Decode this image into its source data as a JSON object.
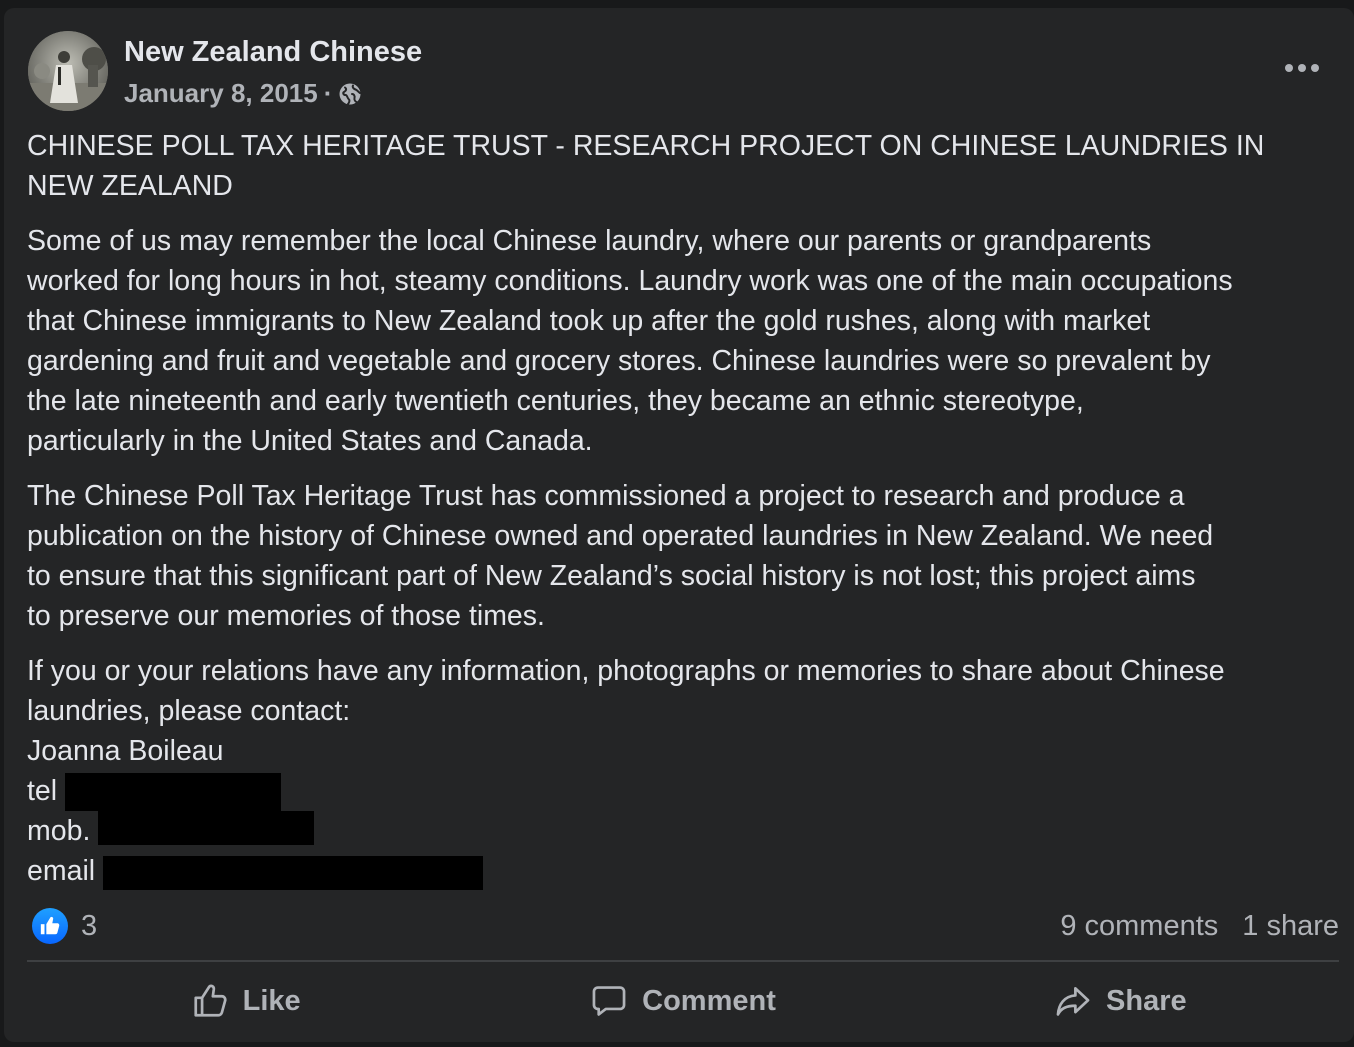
{
  "post": {
    "page_name": "New Zealand Chinese",
    "date": "January 8, 2015",
    "separator": "·",
    "privacy_icon": "globe-icon",
    "more_icon": "more-horizontal-icon",
    "heading_lines": [
      "CHINESE POLL TAX HERITAGE TRUST - RESEARCH PROJECT ON CHINESE LAUNDRIES IN",
      "NEW ZEALAND"
    ],
    "paragraph1_lines": [
      "Some of us may remember the local Chinese laundry, where our parents or grandparents",
      "worked for long hours in hot, steamy conditions. Laundry work was one of the main occupations",
      "that Chinese immigrants to New Zealand took up after the gold rushes, along with market",
      "gardening and fruit and vegetable and grocery stores. Chinese laundries were so prevalent by",
      "the late nineteenth and early twentieth centuries, they became an ethnic stereotype,",
      "particularly in the United States and Canada."
    ],
    "paragraph2_lines": [
      "The Chinese Poll Tax Heritage Trust has commissioned a project to research and produce a",
      "publication on the history of Chinese owned and operated laundries in New Zealand. We need",
      "to ensure that this significant part of New Zealand’s social history is not lost; this project aims",
      "to preserve our memories of those times."
    ],
    "paragraph3_lines": [
      "If you or your relations have any information, photographs or memories to share about Chinese",
      "laundries, please contact:"
    ],
    "contact_name": "Joanna Boileau",
    "tel_label": "tel",
    "mob_label": "mob.",
    "email_label": "email"
  },
  "stats": {
    "like_icon": "thumbs-up-icon",
    "reaction_count": "3",
    "comments": "9 comments",
    "shares": "1 share"
  },
  "actions": {
    "like": "Like",
    "comment": "Comment",
    "share": "Share"
  },
  "colors": {
    "card_background": "#242526",
    "text_primary": "#e4e6eb",
    "text_secondary": "#b0b3b8",
    "like_blue": "#0866ff",
    "redaction": "#000000"
  }
}
